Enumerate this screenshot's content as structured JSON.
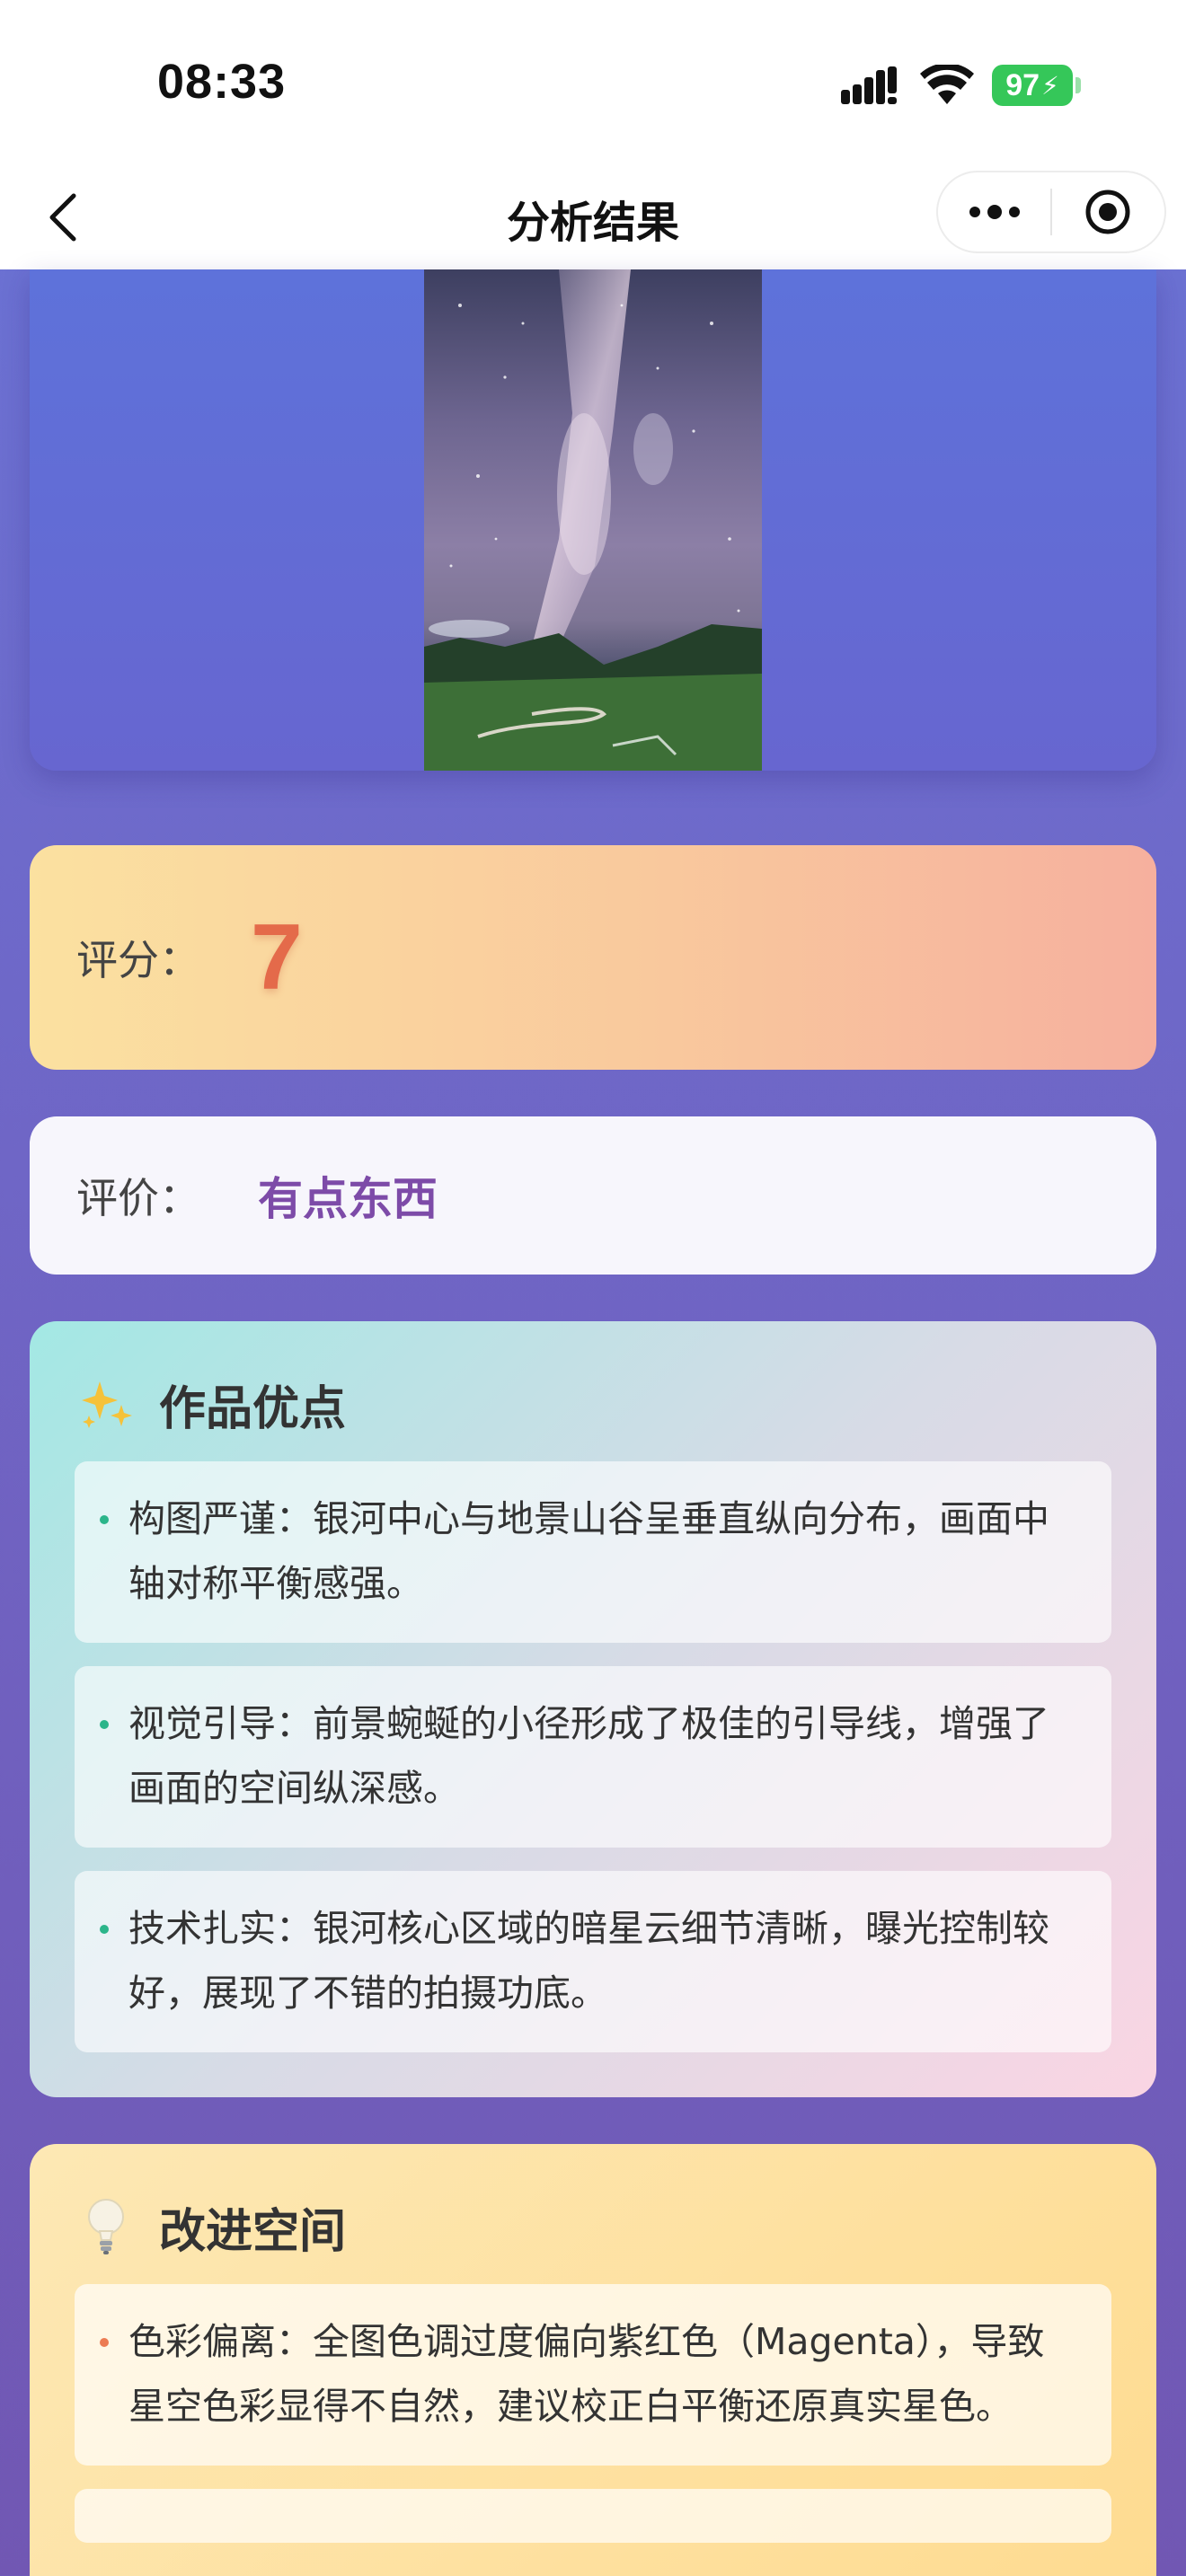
{
  "status_bar": {
    "time": "08:33",
    "battery": "97"
  },
  "nav": {
    "title": "分析结果"
  },
  "score": {
    "label": "评分：",
    "value": "7"
  },
  "comment": {
    "label": "评价：",
    "value": "有点东西"
  },
  "pros": {
    "title": "作品优点",
    "icon": "sparkles-icon",
    "items": [
      {
        "text": "构图严谨：银河中心与地景山谷呈垂直纵向分布，画面中轴对称平衡感强。"
      },
      {
        "text": "视觉引导：前景蜿蜒的小径形成了极佳的引导线，增强了画面的空间纵深感。"
      },
      {
        "text": "技术扎实：银河核心区域的暗星云细节清晰，曝光控制较好，展现了不错的拍摄功底。"
      }
    ]
  },
  "cons": {
    "title": "改进空间",
    "icon": "lightbulb-icon",
    "items": [
      {
        "text": "色彩偏离：全图色调过度偏向紫红色（Magenta），导致星空色彩显得不自然，建议校正白平衡还原真实星色。"
      }
    ]
  },
  "colors": {
    "accent_score": "#e46a4a",
    "accent_comment": "#7d4ba8",
    "battery": "#35c759"
  }
}
